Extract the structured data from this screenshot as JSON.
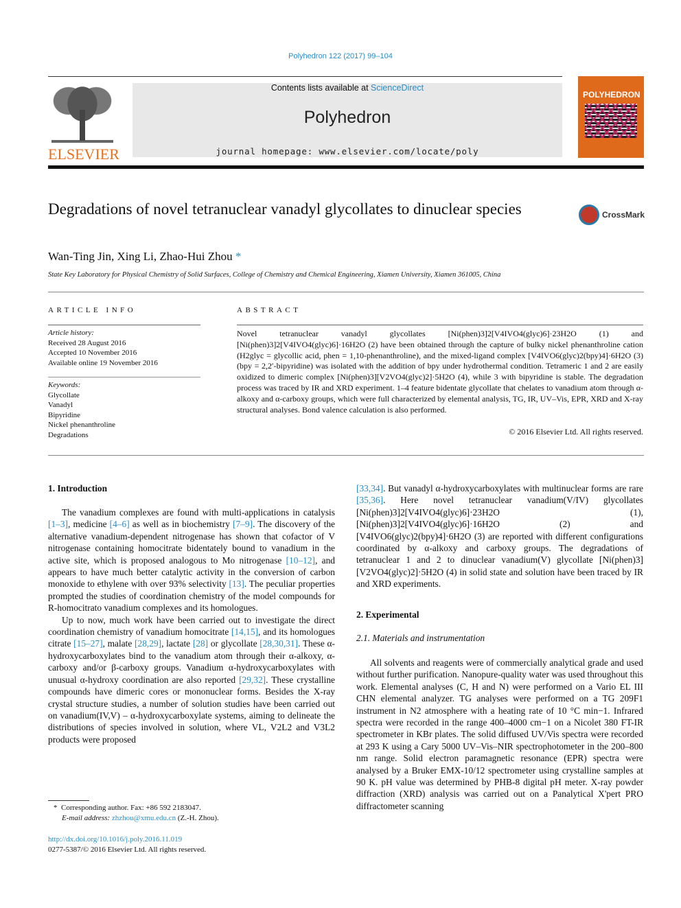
{
  "header": {
    "citation": "Polyhedron 122 (2017) 99–104",
    "publisher_logo": "ELSEVIER",
    "contents_prefix": "Contents lists available at ",
    "contents_link": "ScienceDirect",
    "journal_title": "Polyhedron",
    "homepage": "journal homepage: www.elsevier.com/locate/poly",
    "cover_title": "POLYHEDRON"
  },
  "article": {
    "title": "Degradations of novel tetranuclear vanadyl glycollates to dinuclear species",
    "crossmark_label": "CrossMark",
    "authors": "Wan-Ting Jin, Xing Li, Zhao-Hui Zhou",
    "author_mark": "*",
    "affiliation": "State Key Laboratory for Physical Chemistry of Solid Surfaces, College of Chemistry and Chemical Engineering, Xiamen University, Xiamen 361005, China"
  },
  "article_info": {
    "label": "ARTICLE INFO",
    "history_label": "Article history:",
    "history": [
      "Received 28 August 2016",
      "Accepted 10 November 2016",
      "Available online 19 November 2016"
    ],
    "keywords_label": "Keywords:",
    "keywords": [
      "Glycollate",
      "Vanadyl",
      "Bipyridine",
      "Nickel phenanthroline",
      "Degradations"
    ]
  },
  "abstract": {
    "label": "ABSTRACT",
    "text": "Novel tetranuclear vanadyl glycollates [Ni(phen)3]2[V4IVO4(glyc)6]·23H2O (1) and [Ni(phen)3]2[V4IVO4(glyc)6]·16H2O (2) have been obtained through the capture of bulky nickel phenanthroline cation (H2glyc = glycollic acid, phen = 1,10-phenanthroline), and the mixed-ligand complex [V4IVO6(glyc)2(bpy)4]·6H2O (3) (bpy = 2,2′-bipyridine) was isolated with the addition of bpy under hydrothermal condition. Tetrameric 1 and 2 are easily oxidized to dimeric complex [Ni(phen)3][V2VO4(glyc)2]·5H2O (4), while 3 with bipyridine is stable. The degradation process was traced by IR and XRD experiment. 1–4 feature bidentate glycollate that chelates to vanadium atom through α-alkoxy and α-carboxy groups, which were full characterized by elemental analysis, TG, IR, UV–Vis, EPR, XRD and X-ray structural analyses. Bond valence calculation is also performed.",
    "copyright": "© 2016 Elsevier Ltd. All rights reserved."
  },
  "intro": {
    "heading": "1. Introduction",
    "p1_a": "The vanadium complexes are found with multi-applications in catalysis ",
    "ref1": "[1–3]",
    "p1_b": ", medicine ",
    "ref2": "[4–6]",
    "p1_c": " as well as in biochemistry ",
    "ref3": "[7–9]",
    "p1_d": ". The discovery of the alternative vanadium-dependent nitrogenase has shown that cofactor of V nitrogenase containing homocitrate bidentately bound to vanadium in the active site, which is proposed analogous to Mo nitrogenase ",
    "ref4": "[10–12]",
    "p1_e": ", and appears to have much better catalytic activity in the conversion of carbon monoxide to ethylene with over 93% selectivity ",
    "ref5": "[13]",
    "p1_f": ". The peculiar properties prompted the studies of coordination chemistry of the model compounds for R-homocitrato vanadium complexes and its homologues.",
    "p2_a": "Up to now, much work have been carried out to investigate the direct coordination chemistry of vanadium homocitrate ",
    "ref6": "[14,15]",
    "p2_b": ", and its homologues citrate ",
    "ref7": "[15–27]",
    "p2_c": ", malate ",
    "ref8": "[28,29]",
    "p2_d": ", lactate ",
    "ref9": "[28]",
    "p2_e": " or glycollate ",
    "ref10": "[28,30,31]",
    "p2_f": ". These α-hydroxycarboxylates bind to the vanadium atom through their α-alkoxy, α-carboxy and/or β-carboxy groups. Vanadium α-hydroxycarboxylates with unusual α-hydroxy coordination are also reported ",
    "ref11": "[29,32]",
    "p2_g": ". These crystalline compounds have dimeric cores or mononuclear forms. Besides the X-ray crystal structure studies, a number of solution studies have been carried out on vanadium(IV,V) – α-hydroxycarboxylate systems, aiming to delineate the distributions of species involved in solution, where VL, V2L2 and V3L2 products were proposed"
  },
  "right_col": {
    "ref12": "[33,34]",
    "p3_a": ". But vanadyl α-hydroxycarboxylates with multinuclear forms are rare ",
    "ref13": "[35,36]",
    "p3_b": ". Here novel tetranuclear vanadium(V/IV) glycollates [Ni(phen)3]2[V4IVO4(glyc)6]·23H2O (1), [Ni(phen)3]2[V4IVO4(glyc)6]·16H2O (2) and [V4IVO6(glyc)2(bpy)4]·6H2O (3) are reported with different configurations coordinated by α-alkoxy and carboxy groups. The degradations of tetranuclear 1 and 2 to dinuclear vanadium(V) glycollate [Ni(phen)3][V2VO4(glyc)2]·5H2O (4) in solid state and solution have been traced by IR and XRD experiments.",
    "exp_heading": "2. Experimental",
    "sub_heading": "2.1. Materials and instrumentation",
    "p4": "All solvents and reagents were of commercially analytical grade and used without further purification. Nanopure-quality water was used throughout this work. Elemental analyses (C, H and N) were performed on a Vario EL III CHN elemental analyzer. TG analyses were performed on a TG 209F1 instrument in N2 atmosphere with a heating rate of 10 °C min−1. Infrared spectra were recorded in the range 400–4000 cm−1 on a Nicolet 380 FT-IR spectrometer in KBr plates. The solid diffused UV/Vis spectra were recorded at 293 K using a Cary 5000 UV–Vis–NIR spectrophotometer in the 200–800 nm range. Solid electron paramagnetic resonance (EPR) spectra were analysed by a Bruker EMX-10/12 spectrometer using crystalline samples at 90 K. pH value was determined by PHB-8 digital pH meter. X-ray powder diffraction (XRD) analysis was carried out on a Panalytical X'pert PRO diffractometer scanning"
  },
  "footnote": {
    "mark": "*",
    "corresponding": "Corresponding author. Fax: +86 592 2183047.",
    "email_label": "E-mail address: ",
    "email": "zhzhou@xmu.edu.cn",
    "email_suffix": " (Z.-H. Zhou).",
    "doi": "http://dx.doi.org/10.1016/j.poly.2016.11.019",
    "issn": "0277-5387/© 2016 Elsevier Ltd. All rights reserved."
  }
}
